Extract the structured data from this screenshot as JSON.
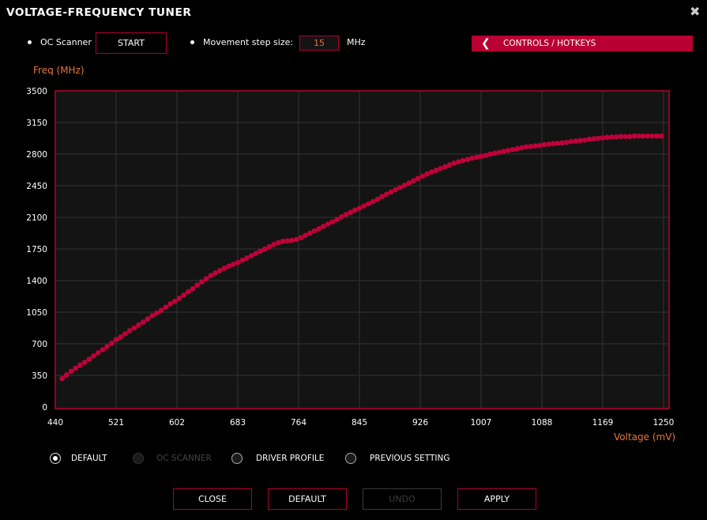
{
  "window": {
    "title": "VOLTAGE-FREQUENCY TUNER",
    "close_icon": "close-icon"
  },
  "toolbar": {
    "oc_scanner_label": "OC Scanner",
    "start_label": "START",
    "step_label": "Movement step size:",
    "step_value": "15",
    "step_unit": "MHz",
    "controls_label": "CONTROLS / HOTKEYS",
    "controls_icon": "chevron-left-icon"
  },
  "colors": {
    "accent": "#b80033",
    "point": "#c0003a",
    "axis_title": "#e8763f",
    "plot_bg": "#141414",
    "grid": "#2a2a2a"
  },
  "chart_data": {
    "type": "scatter",
    "title": "",
    "xlabel": "Voltage (mV)",
    "ylabel": "Freq (MHz)",
    "xlim": [
      440,
      1250
    ],
    "ylim": [
      0,
      3500
    ],
    "grid": true,
    "connected": true,
    "xticks": [
      440,
      521,
      602,
      683,
      764,
      845,
      926,
      1007,
      1088,
      1169,
      1250
    ],
    "yticks": [
      0,
      350,
      700,
      1050,
      1400,
      1750,
      2100,
      2450,
      2800,
      3150,
      3500
    ],
    "points": [
      [
        449,
        315
      ],
      [
        455,
        355
      ],
      [
        461,
        395
      ],
      [
        467,
        430
      ],
      [
        473,
        465
      ],
      [
        479,
        495
      ],
      [
        485,
        530
      ],
      [
        491,
        565
      ],
      [
        497,
        600
      ],
      [
        503,
        635
      ],
      [
        509,
        670
      ],
      [
        515,
        705
      ],
      [
        521,
        745
      ],
      [
        527,
        775
      ],
      [
        533,
        810
      ],
      [
        539,
        845
      ],
      [
        545,
        875
      ],
      [
        551,
        910
      ],
      [
        557,
        940
      ],
      [
        563,
        975
      ],
      [
        569,
        1010
      ],
      [
        575,
        1040
      ],
      [
        581,
        1070
      ],
      [
        587,
        1105
      ],
      [
        593,
        1140
      ],
      [
        599,
        1170
      ],
      [
        605,
        1205
      ],
      [
        611,
        1240
      ],
      [
        617,
        1275
      ],
      [
        623,
        1310
      ],
      [
        629,
        1350
      ],
      [
        635,
        1385
      ],
      [
        641,
        1420
      ],
      [
        647,
        1455
      ],
      [
        653,
        1485
      ],
      [
        659,
        1510
      ],
      [
        665,
        1535
      ],
      [
        671,
        1560
      ],
      [
        677,
        1580
      ],
      [
        683,
        1600
      ],
      [
        689,
        1625
      ],
      [
        695,
        1650
      ],
      [
        701,
        1675
      ],
      [
        707,
        1700
      ],
      [
        713,
        1725
      ],
      [
        719,
        1750
      ],
      [
        725,
        1775
      ],
      [
        731,
        1800
      ],
      [
        737,
        1820
      ],
      [
        743,
        1835
      ],
      [
        749,
        1840
      ],
      [
        755,
        1845
      ],
      [
        761,
        1855
      ],
      [
        767,
        1875
      ],
      [
        773,
        1900
      ],
      [
        779,
        1925
      ],
      [
        785,
        1950
      ],
      [
        791,
        1975
      ],
      [
        797,
        2000
      ],
      [
        803,
        2025
      ],
      [
        809,
        2050
      ],
      [
        815,
        2075
      ],
      [
        821,
        2105
      ],
      [
        827,
        2130
      ],
      [
        833,
        2155
      ],
      [
        839,
        2180
      ],
      [
        845,
        2200
      ],
      [
        851,
        2225
      ],
      [
        857,
        2250
      ],
      [
        863,
        2275
      ],
      [
        869,
        2300
      ],
      [
        875,
        2330
      ],
      [
        881,
        2355
      ],
      [
        887,
        2380
      ],
      [
        893,
        2405
      ],
      [
        899,
        2430
      ],
      [
        905,
        2455
      ],
      [
        911,
        2480
      ],
      [
        917,
        2505
      ],
      [
        923,
        2530
      ],
      [
        929,
        2555
      ],
      [
        935,
        2580
      ],
      [
        941,
        2600
      ],
      [
        947,
        2620
      ],
      [
        953,
        2640
      ],
      [
        959,
        2660
      ],
      [
        965,
        2680
      ],
      [
        971,
        2700
      ],
      [
        977,
        2715
      ],
      [
        983,
        2730
      ],
      [
        989,
        2740
      ],
      [
        995,
        2755
      ],
      [
        1001,
        2765
      ],
      [
        1007,
        2775
      ],
      [
        1013,
        2785
      ],
      [
        1019,
        2800
      ],
      [
        1025,
        2810
      ],
      [
        1031,
        2820
      ],
      [
        1037,
        2830
      ],
      [
        1043,
        2840
      ],
      [
        1049,
        2850
      ],
      [
        1055,
        2860
      ],
      [
        1061,
        2870
      ],
      [
        1067,
        2880
      ],
      [
        1073,
        2885
      ],
      [
        1079,
        2890
      ],
      [
        1085,
        2895
      ],
      [
        1091,
        2905
      ],
      [
        1097,
        2910
      ],
      [
        1103,
        2915
      ],
      [
        1109,
        2920
      ],
      [
        1115,
        2925
      ],
      [
        1121,
        2930
      ],
      [
        1127,
        2940
      ],
      [
        1133,
        2945
      ],
      [
        1139,
        2950
      ],
      [
        1145,
        2955
      ],
      [
        1151,
        2965
      ],
      [
        1157,
        2970
      ],
      [
        1163,
        2975
      ],
      [
        1169,
        2980
      ],
      [
        1175,
        2985
      ],
      [
        1181,
        2990
      ],
      [
        1187,
        2990
      ],
      [
        1193,
        2995
      ],
      [
        1199,
        2995
      ],
      [
        1205,
        2995
      ],
      [
        1211,
        3000
      ],
      [
        1217,
        3000
      ],
      [
        1223,
        3000
      ],
      [
        1229,
        3000
      ],
      [
        1235,
        3000
      ],
      [
        1241,
        3000
      ],
      [
        1247,
        3000
      ]
    ]
  },
  "profiles": [
    {
      "label": "DEFAULT",
      "checked": true,
      "disabled": false
    },
    {
      "label": "OC SCANNER",
      "checked": false,
      "disabled": true
    },
    {
      "label": "DRIVER PROFILE",
      "checked": false,
      "disabled": false
    },
    {
      "label": "PREVIOUS SETTING",
      "checked": false,
      "disabled": false
    }
  ],
  "footer": {
    "close": "CLOSE",
    "default": "DEFAULT",
    "undo": "UNDO",
    "apply": "APPLY"
  }
}
